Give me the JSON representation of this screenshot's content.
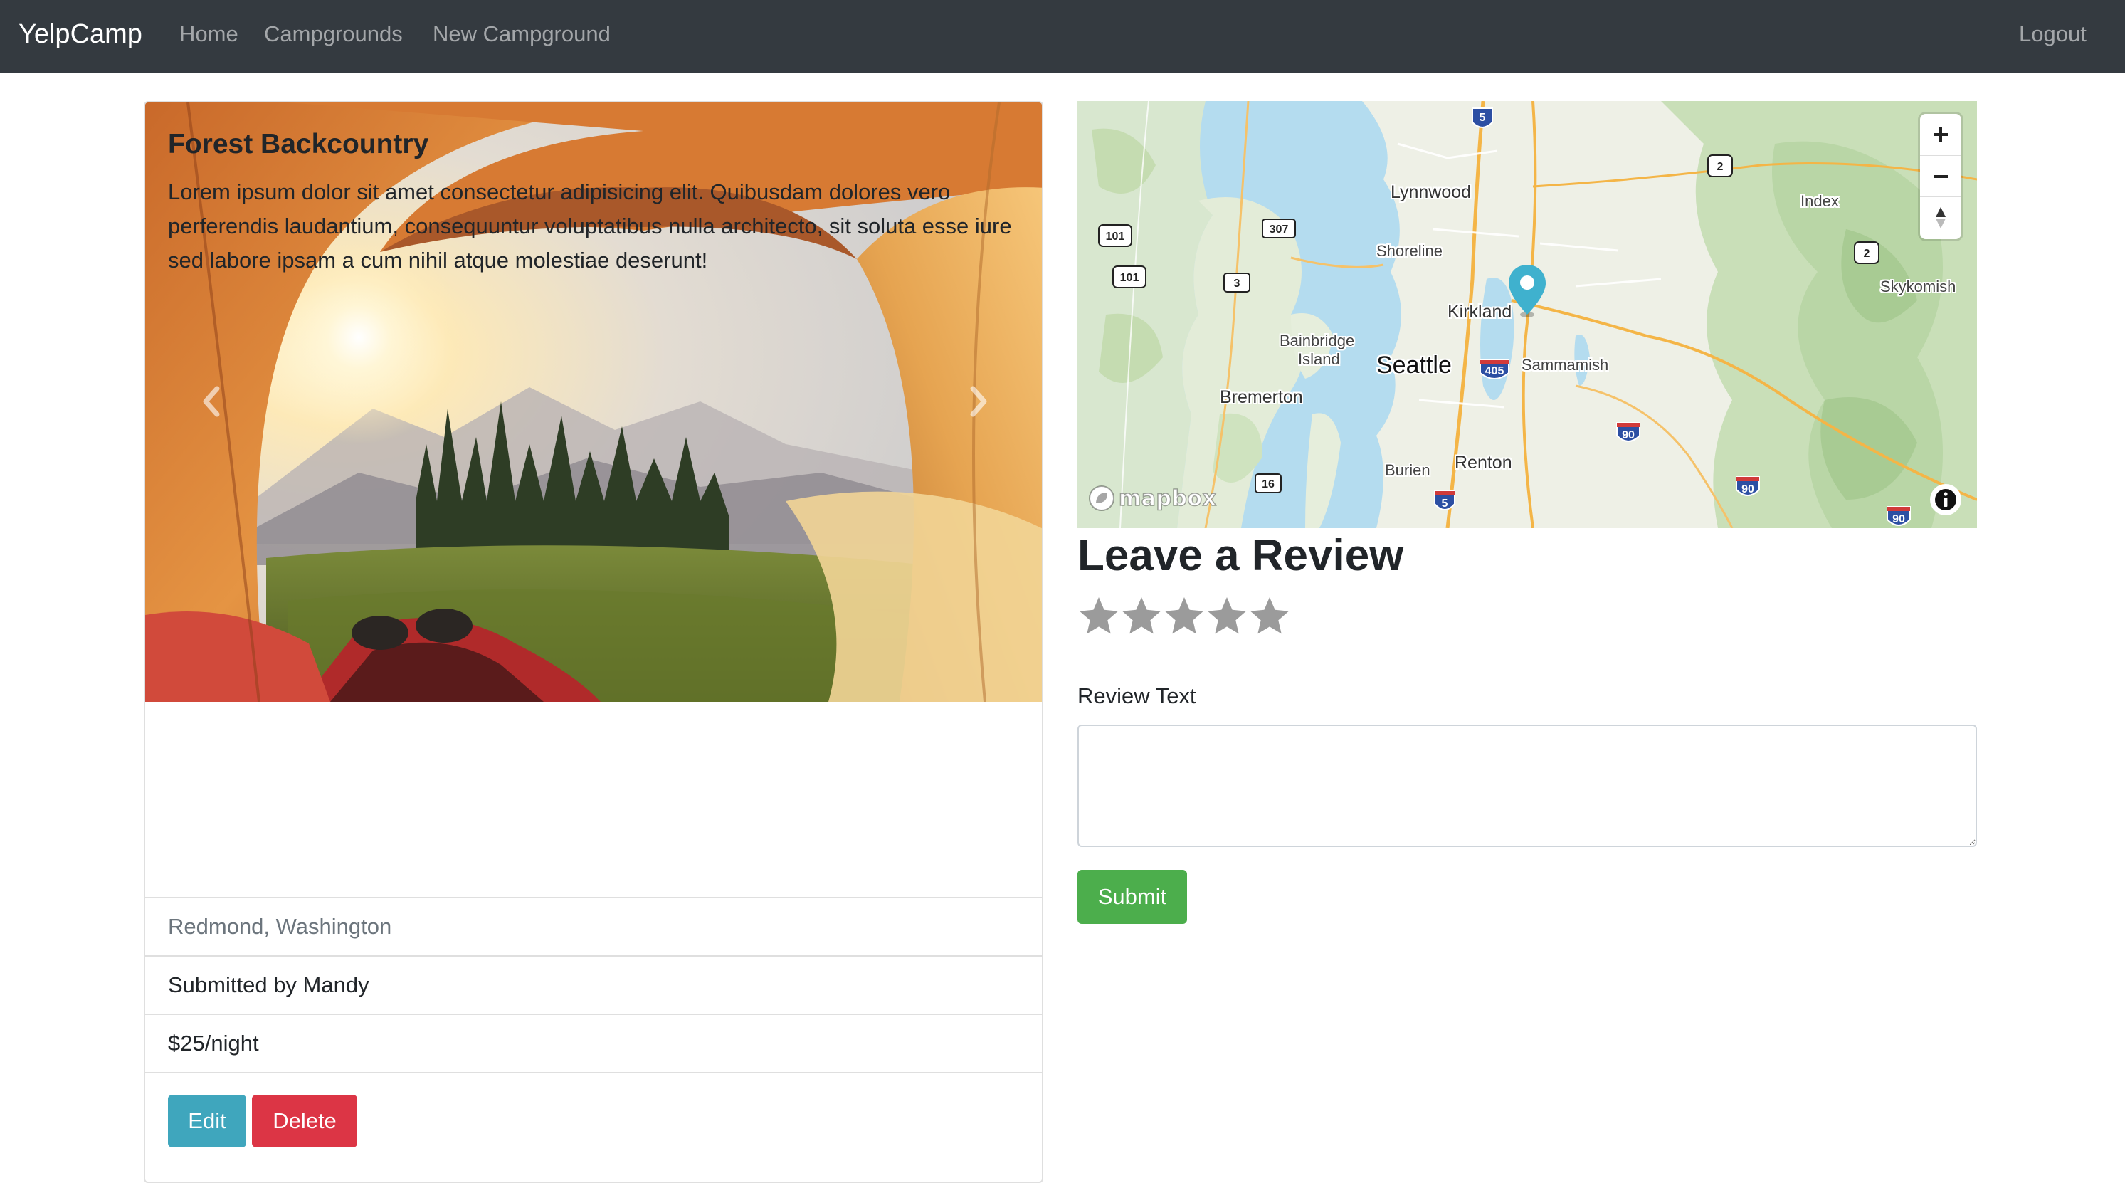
{
  "navbar": {
    "brand": "YelpCamp",
    "links": [
      "Home",
      "Campgrounds",
      "New Campground"
    ],
    "logout": "Logout"
  },
  "campground": {
    "title": "Forest Backcountry",
    "description": "Lorem ipsum dolor sit amet consectetur adipisicing elit. Quibusdam dolores vero perferendis laudantium, consequuntur voluptatibus nulla architecto, sit soluta esse iure sed labore ipsam a cum nihil atque molestiae deserunt!",
    "location": "Redmond, Washington",
    "submitted_by": "Submitted by Mandy",
    "price": "$25/night",
    "edit_label": "Edit",
    "delete_label": "Delete"
  },
  "map": {
    "labels": {
      "lynnwood": "Lynnwood",
      "shoreline": "Shoreline",
      "kirkland": "Kirkland",
      "seattle": "Seattle",
      "sammamish": "Sammamish",
      "bainbridge": "Bainbridge",
      "island": "Island",
      "bremerton": "Bremerton",
      "burien": "Burien",
      "renton": "Renton",
      "index": "Index",
      "skykomish": "Skykomish"
    },
    "shields": {
      "i5": "5",
      "us2a": "2",
      "us2b": "2",
      "us101a": "101",
      "us101b": "101",
      "sr307": "307",
      "sr3": "3",
      "i405": "405",
      "i90a": "90",
      "i90b": "90",
      "i90c": "90",
      "sr16": "16",
      "i5b": "5"
    },
    "attribution_logo": "mapbox"
  },
  "review": {
    "title": "Leave a Review",
    "rating_max": 5,
    "rating_value": 0,
    "text_label": "Review Text",
    "text_value": "",
    "submit_label": "Submit"
  },
  "colors": {
    "navbar_bg": "#343a40",
    "edit_btn": "#3fa6bd",
    "delete_btn": "#dc3545",
    "submit_btn": "#4cae4c",
    "star_empty": "#9b9b9b",
    "map_marker": "#3fb1ce"
  },
  "icons": {
    "carousel_prev": "chevron-left-icon",
    "carousel_next": "chevron-right-icon",
    "zoom_in": "plus-icon",
    "zoom_out": "minus-icon",
    "compass": "compass-icon",
    "info": "info-icon",
    "marker": "map-marker-icon",
    "star": "star-icon"
  }
}
